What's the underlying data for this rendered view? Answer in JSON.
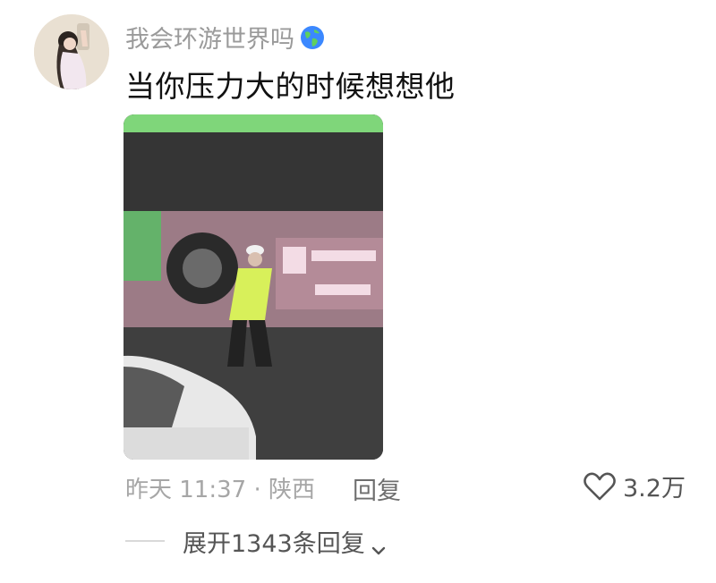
{
  "comment": {
    "username": "我会环游世界吗",
    "username_emoji": "globe-americas",
    "text": "当你压力大的时候想想他",
    "time_location": "昨天 11:37 · 陕西",
    "reply_label": "回复",
    "like_count": "3.2万"
  },
  "replies": {
    "expand_label": "展开1343条回复"
  },
  "colors": {
    "muted_text": "#a6a6a6",
    "main_text": "#111111",
    "bus_green": "#7fd67a",
    "vest_yellow": "#d8f05a"
  }
}
